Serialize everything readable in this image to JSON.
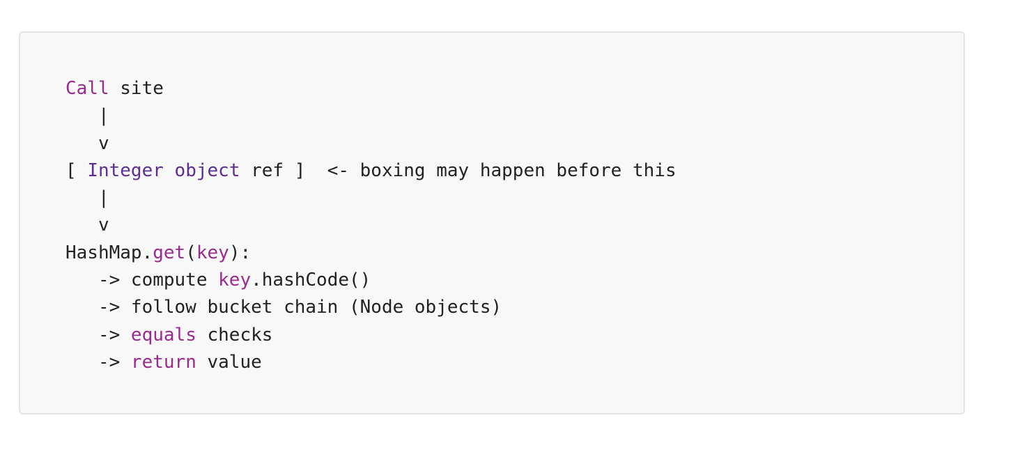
{
  "code_block": {
    "lines": [
      [
        {
          "text": "Call",
          "kind": "keyword"
        },
        {
          "text": " site",
          "kind": "plain"
        }
      ],
      [
        {
          "text": "   |",
          "kind": "plain"
        }
      ],
      [
        {
          "text": "   v",
          "kind": "plain"
        }
      ],
      [
        {
          "text": "[ ",
          "kind": "plain"
        },
        {
          "text": "Integer",
          "kind": "type"
        },
        {
          "text": " ",
          "kind": "plain"
        },
        {
          "text": "object",
          "kind": "type"
        },
        {
          "text": " ref ]  <- boxing may happen before this",
          "kind": "plain"
        }
      ],
      [
        {
          "text": "   |",
          "kind": "plain"
        }
      ],
      [
        {
          "text": "   v",
          "kind": "plain"
        }
      ],
      [
        {
          "text": "HashMap.",
          "kind": "plain"
        },
        {
          "text": "get",
          "kind": "keyword"
        },
        {
          "text": "(",
          "kind": "plain"
        },
        {
          "text": "key",
          "kind": "keyword"
        },
        {
          "text": "):",
          "kind": "plain"
        }
      ],
      [
        {
          "text": "   -> compute ",
          "kind": "plain"
        },
        {
          "text": "key",
          "kind": "keyword"
        },
        {
          "text": ".hashCode()",
          "kind": "plain"
        }
      ],
      [
        {
          "text": "   -> follow bucket chain (Node objects)",
          "kind": "plain"
        }
      ],
      [
        {
          "text": "   -> ",
          "kind": "plain"
        },
        {
          "text": "equals",
          "kind": "keyword"
        },
        {
          "text": " checks",
          "kind": "plain"
        }
      ],
      [
        {
          "text": "   -> ",
          "kind": "plain"
        },
        {
          "text": "return",
          "kind": "keyword"
        },
        {
          "text": " value",
          "kind": "plain"
        }
      ]
    ]
  },
  "colors": {
    "background": "#f8f8f8",
    "border": "#e4e4e4",
    "text": "#222222",
    "keyword": "#9a2a8e",
    "type": "#5b2e91"
  }
}
